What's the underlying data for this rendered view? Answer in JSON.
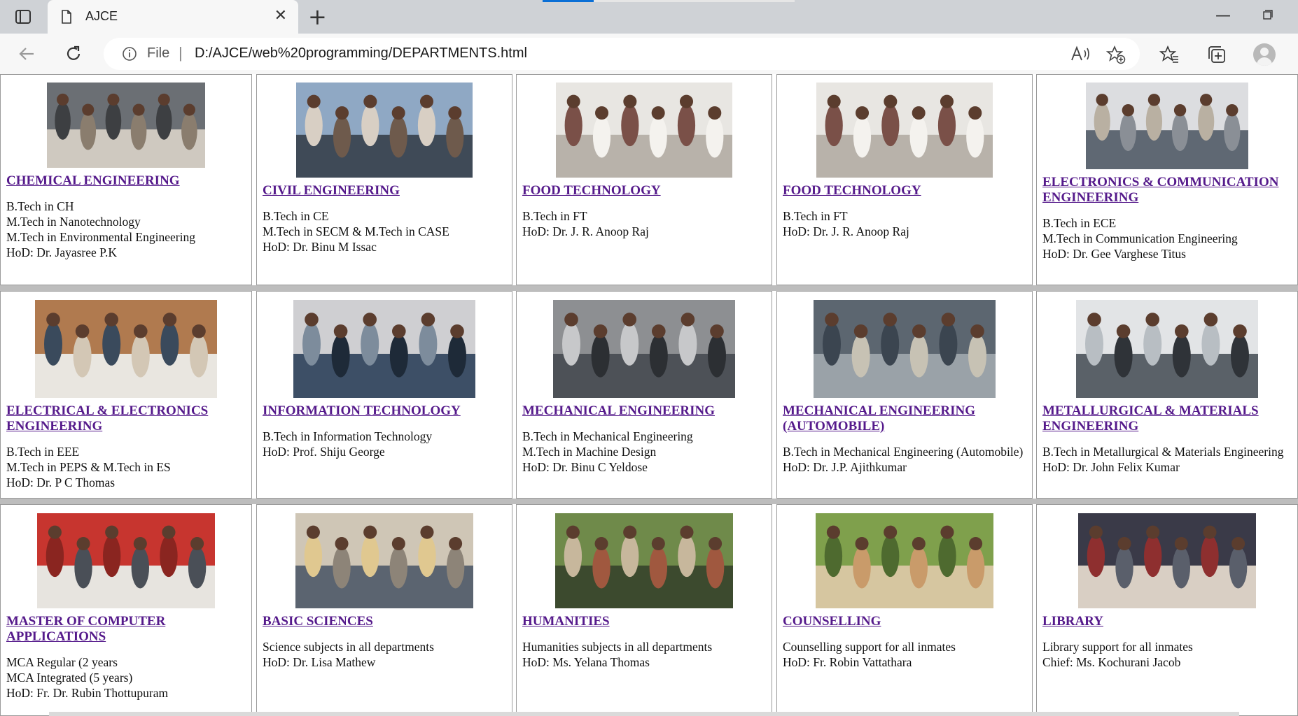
{
  "browser": {
    "tab_title": "AJCE",
    "url_scheme": "File",
    "url": "D:/AJCE/web%20programming/DEPARTMENTS.html",
    "accent": "#0a6fd6"
  },
  "icons": {
    "tab_actions": "tab-actions-icon",
    "page": "page-icon",
    "close": "close-icon",
    "new_tab": "plus-icon",
    "back": "back-arrow-icon",
    "reload": "reload-icon",
    "info": "info-icon",
    "read_aloud": "read-aloud-icon",
    "add_favorite": "star-plus-icon",
    "favorites": "favorites-icon",
    "collections": "collections-icon",
    "profile": "profile-icon"
  },
  "departments": [
    {
      "name": "CHEMICAL ENGINEERING",
      "lines": [
        "B.Tech in CH",
        "M.Tech in Nanotechnology",
        "M.Tech in Environmental Engineering",
        "HoD: Dr. Jayasree P.K"
      ],
      "photo": "students in chemistry lab"
    },
    {
      "name": "CIVIL ENGINEERING",
      "lines": [
        "B.Tech in CE",
        "M.Tech in SECM & M.Tech in CASE",
        "HoD: Dr. Binu M Issac"
      ],
      "photo": "students with surveying instrument"
    },
    {
      "name": "FOOD TECHNOLOGY",
      "lines": [
        "B.Tech in FT",
        "HoD: Dr. J. R. Anoop Raj"
      ],
      "photo": "students in lab coats"
    },
    {
      "name": "FOOD TECHNOLOGY",
      "lines": [
        "B.Tech in FT",
        "HoD: Dr. J. R. Anoop Raj"
      ],
      "photo": "students in lab coats"
    },
    {
      "name": "ELECTRONICS & COMMUNICATION ENGINEERING",
      "lines": [
        "B.Tech in ECE",
        "M.Tech in Communication Engineering",
        "HoD: Dr. Gee Varghese Titus"
      ],
      "photo": "electronics lab"
    },
    {
      "name": "ELECTRICAL & ELECTRONICS ENGINEERING",
      "lines": [
        "B.Tech in EEE",
        "M.Tech in PEPS & M.Tech in ES",
        "HoD: Dr. P C Thomas"
      ],
      "photo": "electrical lab"
    },
    {
      "name": "INFORMATION TECHNOLOGY",
      "lines": [
        "B.Tech in Information Technology",
        "HoD: Prof. Shiju George"
      ],
      "photo": "computer lab"
    },
    {
      "name": "MECHANICAL ENGINEERING",
      "lines": [
        "B.Tech in Mechanical Engineering",
        "M.Tech in Machine Design",
        "HoD: Dr. Binu C Yeldose"
      ],
      "photo": "students at lathe machines"
    },
    {
      "name": "MECHANICAL ENGINEERING (AUTOMOBILE)",
      "lines": [
        "B.Tech in Mechanical Engineering (Automobile)",
        "HoD: Dr. J.P. Ajithkumar"
      ],
      "photo": "automobile workshop"
    },
    {
      "name": "METALLURGICAL & MATERIALS ENGINEERING",
      "lines": [
        "B.Tech in Metallurgical & Materials Engineering",
        "HoD: Dr. John Felix Kumar"
      ],
      "photo": "students at microscopes"
    },
    {
      "name": "MASTER OF COMPUTER APPLICATIONS",
      "lines": [
        "MCA Regular (2 years",
        "MCA Integrated (5 years)",
        "HoD: Fr. Dr. Rubin Thottupuram"
      ],
      "photo": "computer lab with red cubicles"
    },
    {
      "name": "BASIC SCIENCES",
      "lines": [
        "Science subjects in all departments",
        "HoD: Dr. Lisa Mathew"
      ],
      "photo": "classroom"
    },
    {
      "name": "HUMANITIES",
      "lines": [
        "Humanities subjects in all departments",
        "HoD: Ms. Yelana Thomas"
      ],
      "photo": "students sitting outdoors"
    },
    {
      "name": "COUNSELLING",
      "lines": [
        "Counselling support for all inmates",
        "HoD: Fr. Robin Vattathara"
      ],
      "photo": "students walking on campus"
    },
    {
      "name": "LIBRARY",
      "lines": [
        "Library support for all inmates",
        "Chief: Ms. Kochurani Jacob"
      ],
      "photo": "students reading together"
    }
  ]
}
